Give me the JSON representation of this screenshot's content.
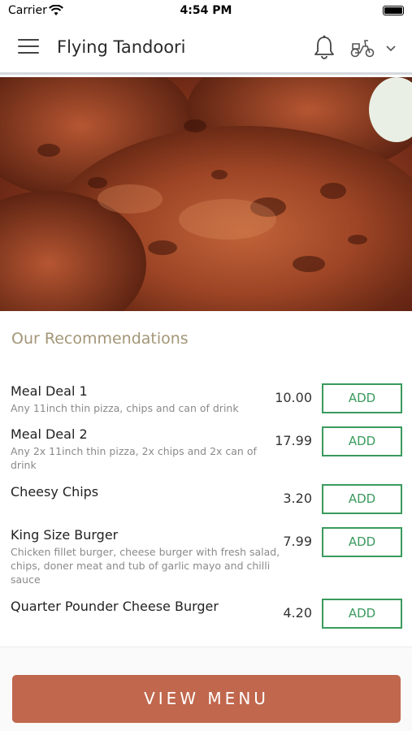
{
  "status_bar": {
    "carrier": "Carrier",
    "time": "4:54 PM"
  },
  "header": {
    "title": "Flying Tandoori"
  },
  "recommendations": {
    "title": "Our Recommendations",
    "items": [
      {
        "name": "Meal Deal 1",
        "description": "Any 11inch thin pizza, chips and can of drink",
        "price": "10.00",
        "add_label": "ADD"
      },
      {
        "name": "Meal Deal 2",
        "description": "Any 2x 11inch thin pizza, 2x chips and 2x can of drink",
        "price": "17.99",
        "add_label": "ADD"
      },
      {
        "name": "Cheesy Chips",
        "description": "",
        "price": "3.20",
        "add_label": "ADD"
      },
      {
        "name": "King Size Burger",
        "description": "Chicken fillet burger, cheese burger with fresh salad, chips, doner meat and tub of garlic mayo and chilli sauce",
        "price": "7.99",
        "add_label": "ADD"
      },
      {
        "name": "Quarter Pounder Cheese Burger",
        "description": "",
        "price": "4.20",
        "add_label": "ADD"
      }
    ]
  },
  "footer": {
    "view_menu_label": "VIEW MENU"
  },
  "colors": {
    "accent": "#c0674d",
    "add_green": "#3a9a5c",
    "section_title": "#a39677"
  },
  "icons": [
    "wifi-icon",
    "battery-icon",
    "hamburger-menu-icon",
    "bell-icon",
    "scooter-icon",
    "chevron-down-icon"
  ]
}
